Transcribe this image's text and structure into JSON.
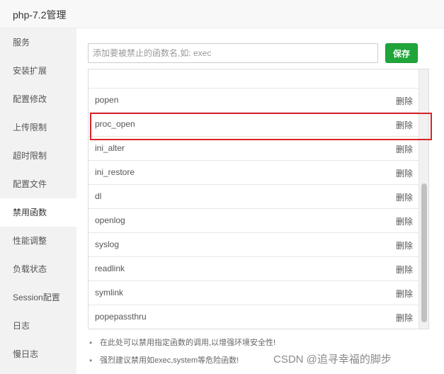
{
  "window": {
    "title": "php-7.2管理"
  },
  "sidebar": {
    "items": [
      {
        "label": "服务"
      },
      {
        "label": "安装扩展"
      },
      {
        "label": "配置修改"
      },
      {
        "label": "上传限制"
      },
      {
        "label": "超时限制"
      },
      {
        "label": "配置文件"
      },
      {
        "label": "禁用函数",
        "active": true
      },
      {
        "label": "性能调整"
      },
      {
        "label": "负载状态"
      },
      {
        "label": "Session配置"
      },
      {
        "label": "日志"
      },
      {
        "label": "慢日志"
      }
    ]
  },
  "main": {
    "input": {
      "placeholder": "添加要被禁止的函数名,如: exec",
      "value": ""
    },
    "save_label": "保存",
    "delete_label": "删除",
    "functions": [
      "popen",
      "proc_open",
      "ini_alter",
      "ini_restore",
      "dl",
      "openlog",
      "syslog",
      "readlink",
      "symlink",
      "popepassthru"
    ],
    "highlighted_function": "proc_open",
    "tips": [
      "在此处可以禁用指定函数的调用,以增强环境安全性!",
      "强烈建议禁用如exec,system等危险函数!"
    ]
  },
  "watermark": "CSDN @追寻幸福的脚步",
  "colors": {
    "accent_green": "#20a53a",
    "highlight_red": "#d9232a"
  }
}
